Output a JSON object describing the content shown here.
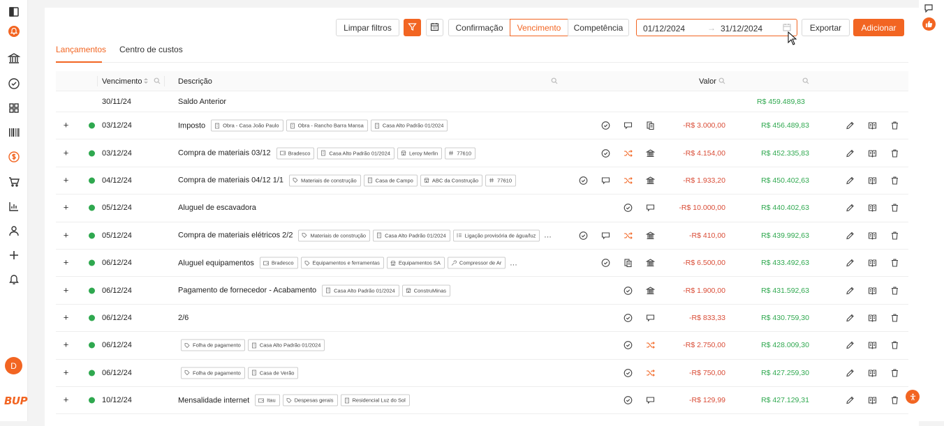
{
  "colors": {
    "accent": "#f26522",
    "positive": "#2fa84f",
    "negative": "#d94c36"
  },
  "sidebar": {
    "icons": [
      "panel-toggle-icon",
      "bell-orange-icon",
      "bank-icon",
      "check-circle-icon",
      "grid-icon",
      "barcode-icon",
      "dollar-icon",
      "cart-icon",
      "chart-icon",
      "user-icon",
      "plus-icon",
      "bell-icon"
    ],
    "avatar_initial": "D",
    "logo_text": "BUP"
  },
  "toolbar": {
    "clear_filters": "Limpar filtros",
    "seg_confirmacao": "Confirmação",
    "seg_vencimento": "Vencimento",
    "seg_competencia": "Competência",
    "date_from": "01/12/2024",
    "date_arrow": "→",
    "date_to": "31/12/2024",
    "export": "Exportar",
    "add": "Adicionar"
  },
  "tabs": {
    "lancamentos": "Lançamentos",
    "centro": "Centro de custos"
  },
  "table": {
    "headers": {
      "vencimento": "Vencimento",
      "descricao": "Descrição",
      "valor": "Valor"
    },
    "saldo": {
      "date": "30/11/24",
      "desc": "Saldo Anterior",
      "balance": "R$ 459.489,83"
    },
    "rows": [
      {
        "date": "03/12/24",
        "desc": "Imposto",
        "tags": [
          {
            "icon": "building",
            "label": "Obra - Casa João Paulo"
          },
          {
            "icon": "building",
            "label": "Obra - Rancho Barra Mansa"
          },
          {
            "icon": "building",
            "label": "Casa Alto Padrão 01/2024"
          }
        ],
        "more": "",
        "icons": [
          "check",
          "repeat",
          "doc"
        ],
        "icon_colors": [
          "#444",
          "#444",
          "#444"
        ],
        "value": "-R$ 3.000,00",
        "balance": "R$ 456.489,83"
      },
      {
        "date": "03/12/24",
        "desc": "Compra de materiais 03/12",
        "tags": [
          {
            "icon": "wallet",
            "label": "Bradesco"
          },
          {
            "icon": "building",
            "label": "Casa Alto Padrão 01/2024"
          },
          {
            "icon": "store",
            "label": "Leroy Merlin"
          },
          {
            "icon": "hash",
            "label": "77610"
          }
        ],
        "more": "",
        "icons": [
          "check",
          "shuffle",
          "bank"
        ],
        "icon_colors": [
          "#444",
          "#f26522",
          "#444"
        ],
        "value": "-R$ 4.154,00",
        "balance": "R$ 452.335,83"
      },
      {
        "date": "04/12/24",
        "desc": "Compra de materiais 04/12 1/1",
        "tags": [
          {
            "icon": "tagi",
            "label": "Materiais de construção"
          },
          {
            "icon": "building",
            "label": "Casa de Campo"
          },
          {
            "icon": "store",
            "label": "ABC da Construção"
          },
          {
            "icon": "hash",
            "label": "77610"
          }
        ],
        "more": "",
        "icons": [
          "check",
          "repeat",
          "shuffle",
          "bank"
        ],
        "icon_colors": [
          "#444",
          "#444",
          "#f26522",
          "#444"
        ],
        "value": "-R$ 1.933,20",
        "balance": "R$ 450.402,63"
      },
      {
        "date": "05/12/24",
        "desc": "Aluguel de escavadora",
        "tags": [],
        "more": "",
        "icons": [
          "check",
          "repeat"
        ],
        "icon_colors": [
          "#444",
          "#444"
        ],
        "value": "-R$ 10.000,00",
        "balance": "R$ 440.402,63"
      },
      {
        "date": "05/12/24",
        "desc": "Compra de materiais elétricos 2/2",
        "tags": [
          {
            "icon": "tagi",
            "label": "Materiais de construção"
          },
          {
            "icon": "building",
            "label": "Casa Alto Padrão 01/2024"
          },
          {
            "icon": "list",
            "label": "Ligação provisória de água/luz"
          }
        ],
        "more": "...",
        "icons": [
          "check",
          "repeat",
          "shuffle",
          "bank"
        ],
        "icon_colors": [
          "#444",
          "#444",
          "#f26522",
          "#444"
        ],
        "value": "-R$ 410,00",
        "balance": "R$ 439.992,63"
      },
      {
        "date": "06/12/24",
        "desc": "Aluguel equipamentos",
        "tags": [
          {
            "icon": "wallet",
            "label": "Bradesco"
          },
          {
            "icon": "tagi",
            "label": "Equipamentos e ferramentas"
          },
          {
            "icon": "store",
            "label": "Equipamentos SA"
          },
          {
            "icon": "tool",
            "label": "Compressor de Ar"
          }
        ],
        "more": "...",
        "icons": [
          "check",
          "doc",
          "bank"
        ],
        "icon_colors": [
          "#444",
          "#444",
          "#444"
        ],
        "value": "-R$ 6.500,00",
        "balance": "R$ 433.492,63"
      },
      {
        "date": "06/12/24",
        "desc": "Pagamento de fornecedor - Acabamento",
        "tags": [
          {
            "icon": "building",
            "label": "Casa Alto Padrão 01/2024"
          },
          {
            "icon": "store",
            "label": "ConstruMinas"
          }
        ],
        "more": "",
        "icons": [
          "check",
          "bank"
        ],
        "icon_colors": [
          "#444",
          "#444"
        ],
        "value": "-R$ 1.900,00",
        "balance": "R$ 431.592,63"
      },
      {
        "date": "06/12/24",
        "desc": "2/6",
        "tags": [],
        "more": "",
        "icons": [
          "check",
          "repeat"
        ],
        "icon_colors": [
          "#444",
          "#444"
        ],
        "value": "-R$ 833,33",
        "balance": "R$ 430.759,30"
      },
      {
        "date": "06/12/24",
        "desc": "",
        "tags": [
          {
            "icon": "tagi",
            "label": "Folha de pagamento"
          },
          {
            "icon": "building",
            "label": "Casa Alto Padrão 01/2024"
          }
        ],
        "more": "",
        "icons": [
          "check",
          "shuffle"
        ],
        "icon_colors": [
          "#444",
          "#f26522"
        ],
        "value": "-R$ 2.750,00",
        "balance": "R$ 428.009,30"
      },
      {
        "date": "06/12/24",
        "desc": "",
        "tags": [
          {
            "icon": "tagi",
            "label": "Folha de pagamento"
          },
          {
            "icon": "building",
            "label": "Casa de Verão"
          }
        ],
        "more": "",
        "icons": [
          "check",
          "shuffle"
        ],
        "icon_colors": [
          "#444",
          "#f26522"
        ],
        "value": "-R$ 750,00",
        "balance": "R$ 427.259,30"
      },
      {
        "date": "10/12/24",
        "desc": "Mensalidade internet",
        "tags": [
          {
            "icon": "wallet",
            "label": "Itau"
          },
          {
            "icon": "tagi",
            "label": "Despesas gerais"
          },
          {
            "icon": "building",
            "label": "Residencial Luz do Sol"
          }
        ],
        "more": "",
        "icons": [
          "check",
          "repeat"
        ],
        "icon_colors": [
          "#444",
          "#444"
        ],
        "value": "-R$ 129,99",
        "balance": "R$ 427.129,31"
      }
    ]
  }
}
